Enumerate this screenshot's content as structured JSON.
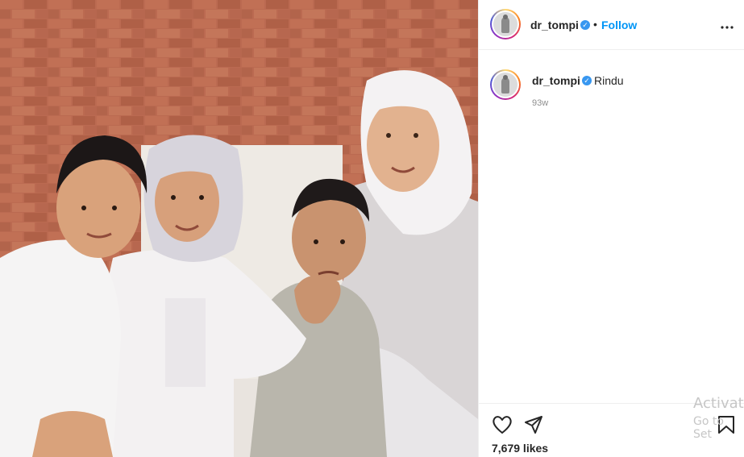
{
  "post": {
    "image_alt": "Family photo: mother in white hijab with three children in white clothing"
  },
  "header": {
    "username": "dr_tompi",
    "separator": "•",
    "follow_label": "Follow",
    "more_label": "•••"
  },
  "caption": {
    "username": "dr_tompi",
    "text": "Rindu",
    "age": "93w"
  },
  "footer": {
    "likes": "7,679 likes"
  },
  "watermark": {
    "line1": "Activate",
    "line2": "Go to Set"
  },
  "colors": {
    "accent": "#0095f6",
    "verified": "#3897f0",
    "divider": "#efefef"
  },
  "icons": [
    "verified-badge-icon",
    "more-options-icon",
    "heart-icon",
    "share-icon",
    "bookmark-icon"
  ]
}
